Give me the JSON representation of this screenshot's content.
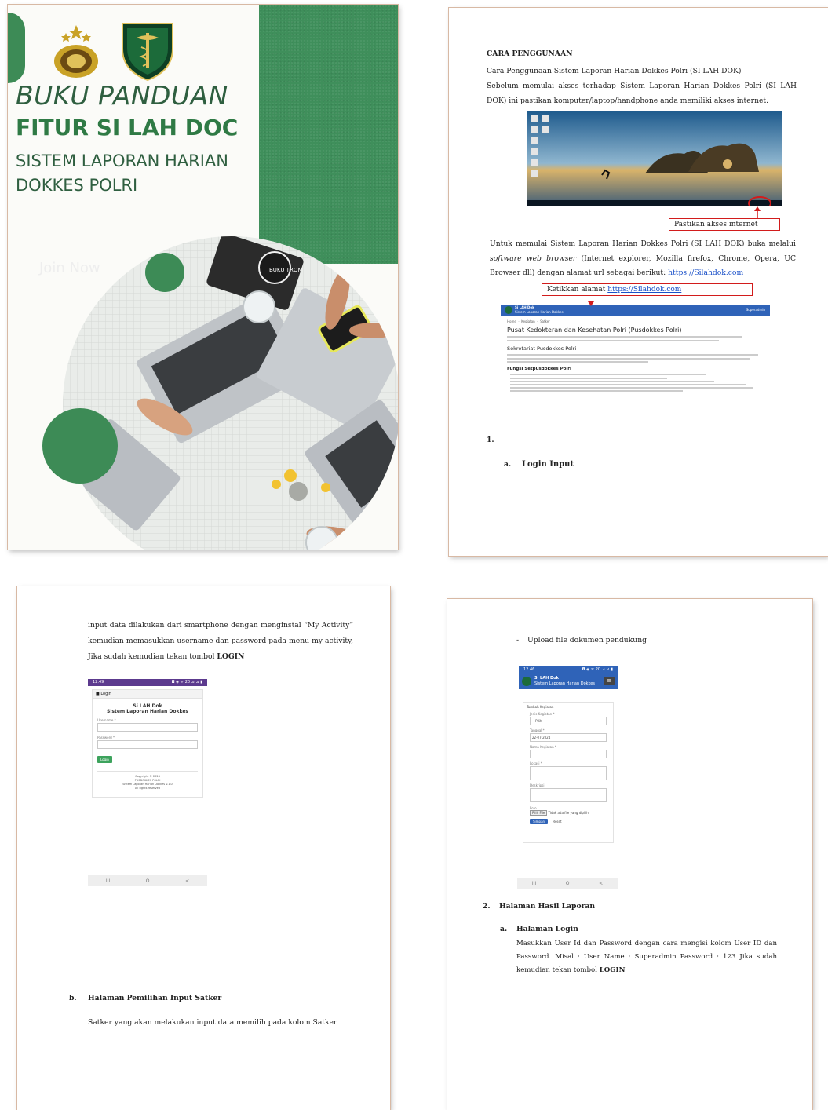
{
  "cover": {
    "title_line1": "BUKU PANDUAN",
    "title_line2": "FITUR SI LAH DOC",
    "subtitle": "SISTEM LAPORAN HARIAN DOKKES POLRI",
    "ghost_text": "Join Now",
    "photo_label": "BUKU TRON",
    "colors": {
      "green": "#3f8f5b",
      "text": "#2f5f40"
    }
  },
  "page2": {
    "heading": "CARA PENGGUNAAN",
    "line1": "Cara Penggunaan Sistem Laporan Harian Dokkes Polri (SI LAH DOK)",
    "para1": "Sebelum memulai akses terhadap Sistem Laporan Harian Dokkes Polri (SI LAH DOK) ini pastikan komputer/laptop/handphone  anda memiliki akses internet.",
    "callout1": "Pastikan akses internet",
    "para2_prefix": "Untuk memulai Sistem Laporan Harian Dokkes Polri (SI LAH DOK) buka melalui ",
    "para2_italic": "software web browser",
    "para2_suffix": " (Internet explorer, Mozilla firefox, Chrome, Opera, UC Browser dll) dengan alamat url sebagai berikut: ",
    "url": "https://Silahdok.com",
    "callout2_prefix": "Ketikkan  alamat ",
    "callout2_url": "https://Silahdok.com",
    "web": {
      "brand_line1": "Si LAH Dok",
      "brand_line2": "Sistem Laporan Harian Dokkes",
      "user": "Superadmin",
      "nav": [
        "Home",
        "Kegiatan",
        "Satker"
      ],
      "h1": "Pusat Kedokteran dan Kesehatan Polri (Pusdokkes Polri)",
      "h2": "Sekretariat Pusdokkes Polri",
      "h3": "Fungsi Setpusdokkes Polri"
    },
    "num1": "1.",
    "sub_a_label": "a.",
    "sub_a": "Login Input"
  },
  "page3": {
    "para": "input data dilakukan dari smartphone dengan menginstal “My Activity” kemudian memasukkan username dan password pada menu my activity, Jika sudah kemudian tekan tombol ",
    "para_bold": "LOGIN",
    "phone": {
      "time": "12.49",
      "status": "◘ ◈ ᯤ 20 ⊿ ⊿ ▮",
      "header": "Login",
      "title1": "Si LAH Dok",
      "title2": "Sistem Laporan Harian Dokkes",
      "username_label": "Username *",
      "password_label": "Password *",
      "login_btn": "Login",
      "footer1": "Copyright © 2024",
      "footer2": "PUSDOKKES POLRI",
      "footer3": "Sistem Laporan Harian Dokkes V.1.0",
      "footer4": "All rights reserved",
      "nav": [
        "III",
        "O",
        "<"
      ]
    },
    "sub_b_label": "b.",
    "sub_b": "Halaman Pemilihan Input Satker",
    "sub_b_text": "Satker yang akan melakukan input data memilih pada kolom Satker"
  },
  "page4": {
    "bullet": "-",
    "upload": "Upload file dokumen pendukung",
    "phone": {
      "time": "12.46",
      "status": "◘ ◈ ᯤ 20 ⊿ ⊿ ▮",
      "brand1": "Si LAH Dok",
      "brand2": "Sistem Laporan Harian Dokkes",
      "form_title": "Tambah Kegiatan",
      "f1_label": "Jenis Kegiatan *",
      "f1_value": "-- Pilih --",
      "f2_label": "Tanggal *",
      "f2_value": "22-07-2024",
      "f3_label": "Nama Kegiatan *",
      "f4_label": "Lokasi *",
      "f5_label": "Deskripsi",
      "f6_label": "Foto",
      "file_btn": "Pilih File",
      "file_text": "Tidak ada file yang dipilih",
      "save_btn": "Simpan",
      "reset_btn": "Reset",
      "nav": [
        "III",
        "O",
        "<"
      ]
    },
    "num2": "2.",
    "sec2": "Halaman Hasil Laporan",
    "sub_a_label": "a.",
    "sub_a": "Halaman Login",
    "para": "Masukkan User Id dan Password dengan cara mengisi kolom User ID dan Password. Misal : User Name : Superadmin Password : 123 Jika sudah kemudian tekan tombol ",
    "para_bold": "LOGIN"
  }
}
